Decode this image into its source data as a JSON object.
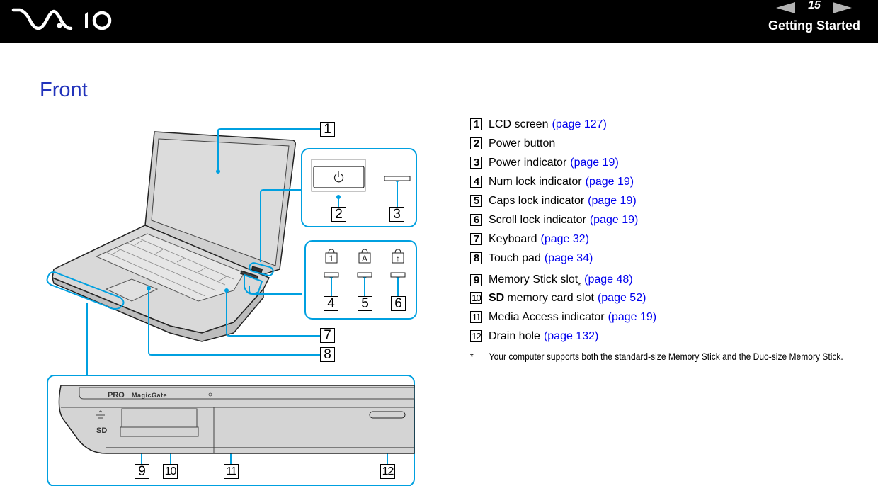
{
  "header": {
    "brand": "VAIO",
    "page_number": "15",
    "section": "Getting Started",
    "prev_label": "previous page",
    "next_label": "next page"
  },
  "page": {
    "title": "Front"
  },
  "legend": [
    {
      "num": "1",
      "label": "LCD screen",
      "link": "(page 127)"
    },
    {
      "num": "2",
      "label": "Power button",
      "link": ""
    },
    {
      "num": "3",
      "label": "Power indicator",
      "link": "(page 19)"
    },
    {
      "num": "4",
      "label": "Num lock indicator",
      "link": "(page 19)"
    },
    {
      "num": "5",
      "label": "Caps lock indicator",
      "link": "(page 19)"
    },
    {
      "num": "6",
      "label": "Scroll lock indicator",
      "link": "(page 19)"
    },
    {
      "num": "7",
      "label": "Keyboard",
      "link": "(page 32)"
    },
    {
      "num": "8",
      "label": "Touch pad",
      "link": "(page 34)"
    },
    {
      "num": "9",
      "label": "Memory Stick slot",
      "sup": "*",
      "link": "(page 48)"
    },
    {
      "num": "10",
      "bold": "SD",
      "label": "memory card slot",
      "link": "(page 52)"
    },
    {
      "num": "11",
      "label": "Media Access indicator",
      "link": "(page 19)"
    },
    {
      "num": "12",
      "label": "Drain hole",
      "link": "(page 132)"
    }
  ],
  "footnote": {
    "marker": "*",
    "text": "Your computer supports both the standard-size Memory Stick and the Duo-size Memory Stick."
  },
  "diagram": {
    "callouts": [
      "1",
      "2",
      "3",
      "4",
      "5",
      "6",
      "7",
      "8",
      "9",
      "10",
      "11",
      "12"
    ],
    "slot_labels": {
      "pro": "PRO",
      "magicgate": "MagicGate",
      "sd": "SD"
    },
    "indicator_glyphs": [
      "1",
      "A",
      "↕"
    ],
    "colors": {
      "callout_line": "#00a0e0",
      "device_fill": "#d4d4d4",
      "title": "#2233bb",
      "link": "#0000ee"
    }
  }
}
